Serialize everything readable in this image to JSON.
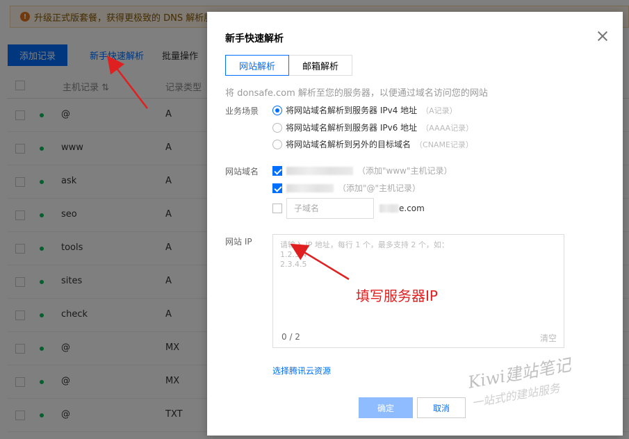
{
  "background": {
    "banner_icon": "!",
    "banner_text": "升级正式版套餐，获得更极致的 DNS 解析服务",
    "toolbar": {
      "add_record": "添加记录",
      "quick_resolve": "新手快速解析",
      "batch": "批量操作"
    },
    "columns": {
      "host": "主机记录",
      "sort_icon": "⇅",
      "type": "记录类型"
    },
    "rows": [
      {
        "host": "@",
        "type": "A"
      },
      {
        "host": "www",
        "type": "A"
      },
      {
        "host": "ask",
        "type": "A"
      },
      {
        "host": "seo",
        "type": "A"
      },
      {
        "host": "tools",
        "type": "A"
      },
      {
        "host": "sites",
        "type": "A"
      },
      {
        "host": "check",
        "type": "A"
      },
      {
        "host": "@",
        "type": "MX"
      },
      {
        "host": "@",
        "type": "MX"
      },
      {
        "host": "@",
        "type": "TXT"
      }
    ]
  },
  "dialog": {
    "title": "新手快速解析",
    "tabs": [
      "网站解析",
      "邮箱解析"
    ],
    "description": "将 donsafe.com 解析至您的服务器，以便通过域名访问您的网站",
    "scene": {
      "label": "业务场景",
      "options": [
        {
          "text": "将网站域名解析到服务器 IPv4 地址",
          "hint": "（A记录）"
        },
        {
          "text": "将网站域名解析到服务器 IPv6 地址",
          "hint": "（AAAA记录）"
        },
        {
          "text": "将网站域名解析到另外的目标域名",
          "hint": "（CNAME记录）"
        }
      ]
    },
    "domain": {
      "label": "网站域名",
      "hint_www": "（添加\"www\"主机记录）",
      "hint_at": "（添加\"@\"主机记录）",
      "sub_placeholder": "子域名",
      "suffix": "e.com"
    },
    "ip": {
      "label": "网站 IP",
      "placeholder": "请输入 IP 地址，每行 1 个，最多支持 2 个，如：\n1.2.3.4\n2.3.4.5",
      "count": "0 / 2",
      "clear": "清空"
    },
    "select_resource": "选择腾讯云资源",
    "ok": "确定",
    "cancel": "取消"
  },
  "annotation": "填写服务器IP",
  "watermark": {
    "line1": "Kiwi建站笔记",
    "line2": "一站式的建站服务"
  },
  "colors": {
    "primary": "#006eff",
    "annotation": "#e02020",
    "status_ok": "#0abf5b"
  }
}
